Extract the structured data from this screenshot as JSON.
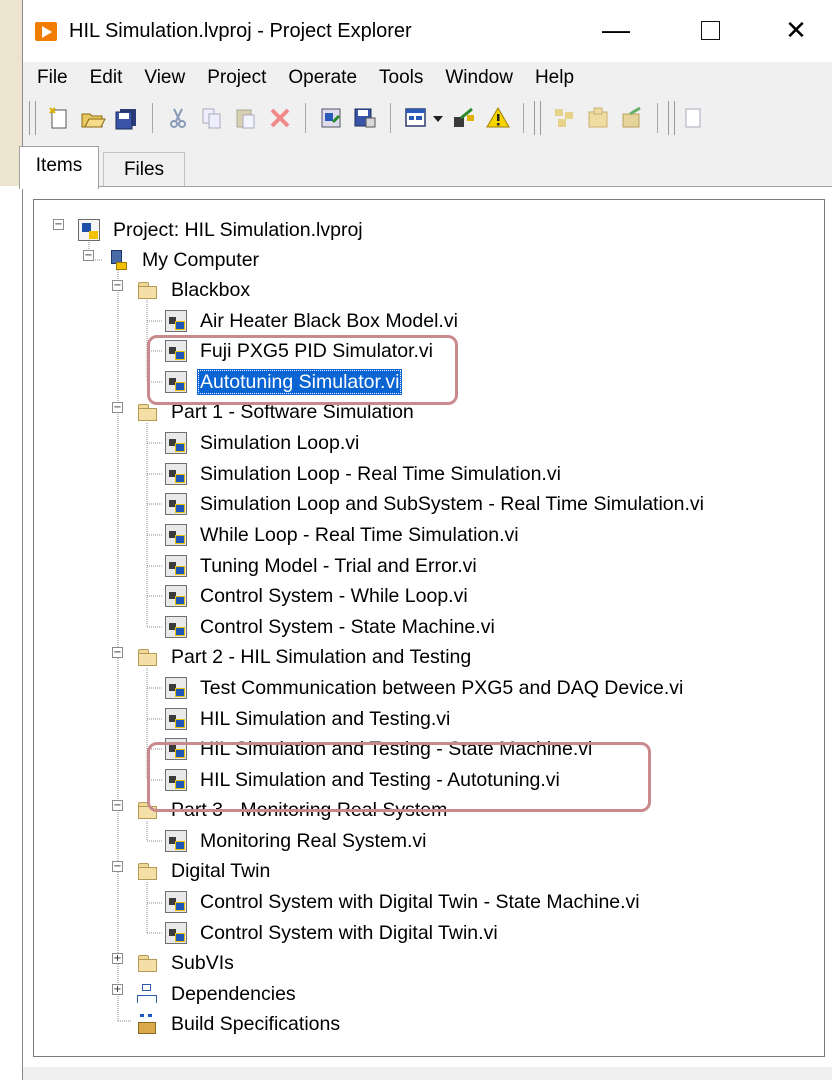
{
  "window": {
    "title": "HIL Simulation.lvproj - Project Explorer",
    "controls": {
      "minimize": "—",
      "close": "✕"
    }
  },
  "menubar": [
    "File",
    "Edit",
    "View",
    "Project",
    "Operate",
    "Tools",
    "Window",
    "Help"
  ],
  "toolbar": {
    "buttons": [
      "new-icon",
      "open-icon",
      "save-all-icon",
      "cut-icon",
      "copy-icon",
      "paste-icon",
      "delete-icon",
      "add-file-icon",
      "save-icon",
      "view-icon",
      "dropdown-icon",
      "build-icon",
      "warning-icon",
      "source-control-icon",
      "package-icon",
      "deploy-icon"
    ]
  },
  "tabs": {
    "items": "Items",
    "files": "Files"
  },
  "tree": {
    "project": "Project: HIL Simulation.lvproj",
    "computer": "My Computer",
    "blackbox": {
      "label": "Blackbox",
      "items": [
        "Air Heater Black Box Model.vi",
        "Fuji PXG5 PID Simulator.vi",
        "Autotuning Simulator.vi"
      ]
    },
    "part1": {
      "label": "Part 1 - Software Simulation",
      "items": [
        "Simulation Loop.vi",
        "Simulation Loop - Real Time Simulation.vi",
        "Simulation Loop and SubSystem - Real Time Simulation.vi",
        "While Loop - Real Time Simulation.vi",
        "Tuning Model - Trial and Error.vi",
        "Control System - While Loop.vi",
        "Control System - State Machine.vi"
      ]
    },
    "part2": {
      "label": "Part 2 - HIL Simulation and Testing",
      "items": [
        "Test Communication between PXG5 and DAQ Device.vi",
        "HIL Simulation and Testing.vi",
        "HIL Simulation and Testing - State Machine.vi",
        "HIL Simulation and Testing - Autotuning.vi"
      ]
    },
    "part3": {
      "label": "Part 3 - Monitoring Real System",
      "items": [
        "Monitoring Real System.vi"
      ]
    },
    "twin": {
      "label": "Digital Twin",
      "items": [
        "Control System with Digital Twin - State Machine.vi",
        "Control System with Digital Twin.vi"
      ]
    },
    "subvis": "SubVIs",
    "dependencies": "Dependencies",
    "build": "Build Specifications"
  },
  "selected_item": "Autotuning Simulator.vi",
  "colors": {
    "selection": "#0a64d2",
    "annotation": "#c98a8e",
    "accent": "#f07c00"
  }
}
